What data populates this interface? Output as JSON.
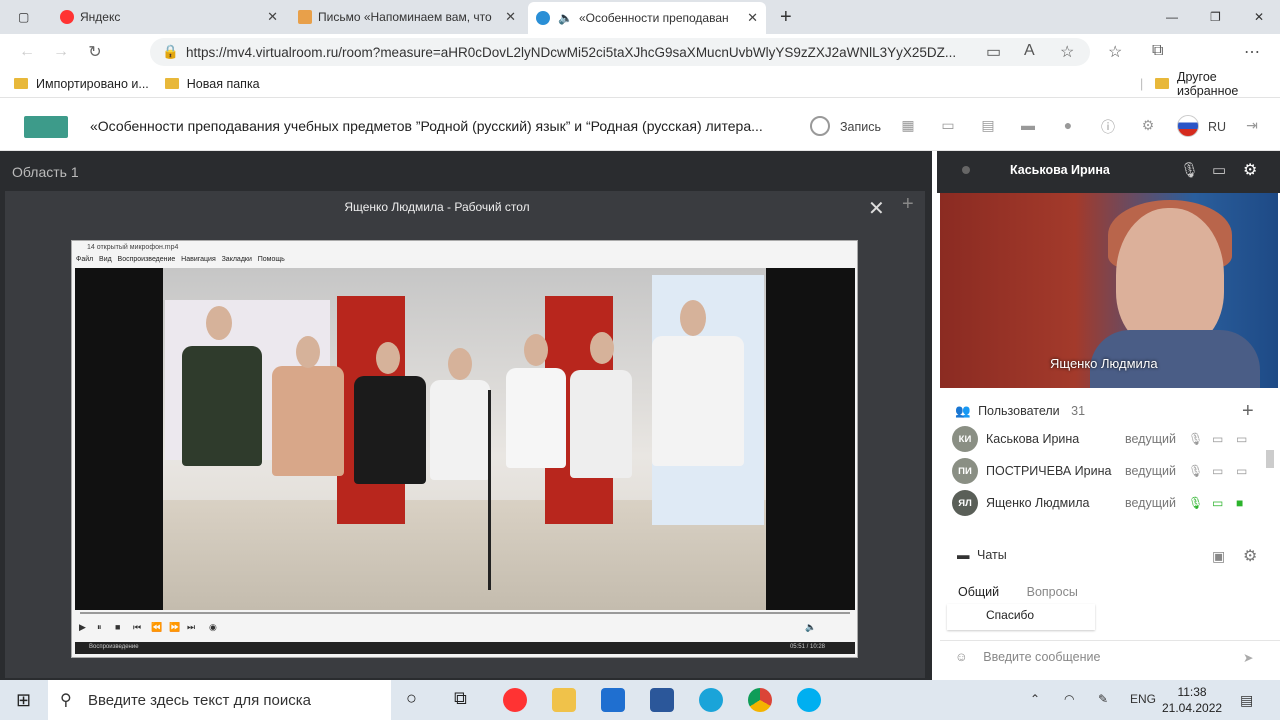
{
  "browser": {
    "tabs": [
      {
        "title": "Яндекс"
      },
      {
        "title": "Письмо «Напоминаем вам, что"
      },
      {
        "title": "«Особенности преподаван"
      }
    ],
    "url": "https://mv4.virtualroom.ru/room?measure=aHR0cDovL2lyNDcwMi52ci5taXJhcG9saXMucnUvbWlyYS9zZXJ2aWNlL3YyX25DZ...",
    "bookmarks": [
      "Импортировано и...",
      "Новая папка"
    ],
    "other_bookmarks": "Другое избранное"
  },
  "app": {
    "title": "«Особенности преподавания учебных предметов ”Родной (русский) язык” и “Родная (русская) литера...",
    "record": "Запись",
    "lang": "RU"
  },
  "stage": {
    "area_title": "Область 1",
    "panel_title": "Ященко Людмила - Рабочий стол",
    "player_title": "14 открытый микрофон.mp4",
    "player_menu": "Файл   Вид   Воспроизведение   Навигация   Закладки   Помощь",
    "player_status": "Воспроизведение",
    "player_time": "05:51 / 10:28"
  },
  "video_panel": {
    "name": "Каськова Ирина",
    "cam_label": "Ященко Людмила"
  },
  "users": {
    "title": "Пользователи",
    "count": "31",
    "list": [
      {
        "initials": "КИ",
        "name": "Каськова Ирина",
        "role": "ведущий"
      },
      {
        "initials": "ПИ",
        "name": "ПОСТРИЧЕВА Ирина",
        "role": "ведущий"
      },
      {
        "initials": "ЯЛ",
        "name": "Ященко Людмила",
        "role": "ведущий"
      }
    ]
  },
  "chat": {
    "title": "Чаты",
    "tab_general": "Общий",
    "tab_questions": "Вопросы",
    "last_message": "Спасибо",
    "placeholder": "Введите сообщение"
  },
  "taskbar": {
    "search": "Введите здесь текст для поиска",
    "lang": "ENG",
    "time": "11:38",
    "date": "21.04.2022"
  }
}
